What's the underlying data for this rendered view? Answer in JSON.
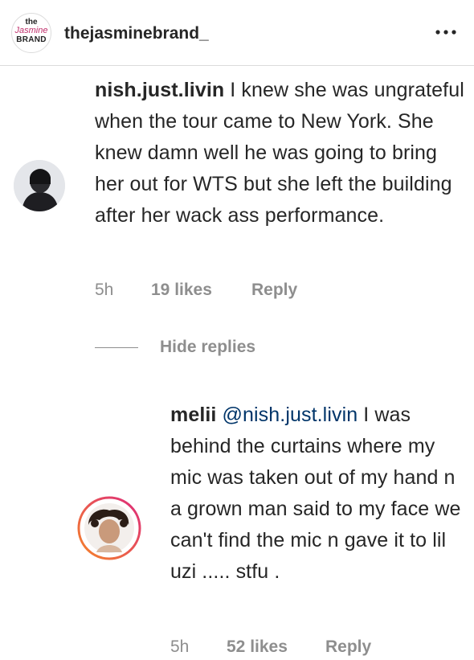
{
  "header": {
    "logo_line1": "the",
    "logo_line2": "Jasmine",
    "logo_line3": "BRAND",
    "username": "thejasminebrand_",
    "more_icon": "more-horizontal-icon"
  },
  "comments": [
    {
      "author": "nish.just.livin",
      "text": "I knew she was ungrateful when the tour came to New York. She knew damn well he was going to bring her out for WTS but she left the building after her wack ass performance.",
      "time": "5h",
      "likes": "19 likes",
      "reply": "Reply"
    }
  ],
  "thread": {
    "hide_replies": "Hide replies"
  },
  "replies": [
    {
      "author": "melii",
      "mention": "@nish.just.livin",
      "text": "I was behind the curtains where my mic was taken out of my hand n a grown man said to my face we can't find the mic n gave it to lil uzi ..... stfu .",
      "time": "5h",
      "likes": "52 likes",
      "reply": "Reply"
    }
  ],
  "colors": {
    "text": "#262626",
    "secondary": "#8e8e8e",
    "mention": "#003569",
    "story_ring_start": "#f58529",
    "story_ring_end": "#dd2a7b"
  }
}
